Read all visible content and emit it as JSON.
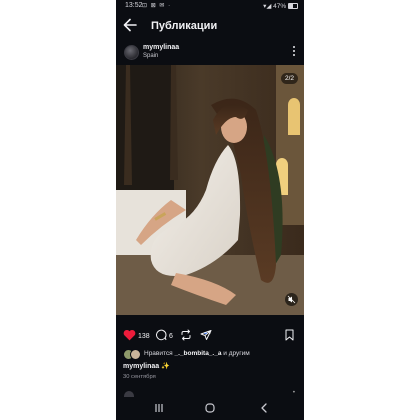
{
  "status_bar": {
    "time": "13:52",
    "left_icons": "⊡ ⊠ ✉ ·",
    "battery": "47%"
  },
  "header": {
    "title": "Публикации",
    "back_icon": "arrow-left-icon"
  },
  "post": {
    "username": "mymylinaa",
    "location": "Spain",
    "media_counter": "2/2",
    "likes": "138",
    "comments": "6",
    "liked_by_prefix": "Нравится ",
    "liked_by_user": "_._bombita_._a",
    "liked_by_suffix": " и другим",
    "caption_user": "mymylinaa",
    "caption_text": " ✨",
    "date": "30 сентября"
  },
  "colors": {
    "background": "#0b0d12",
    "like": "#ed1c3b",
    "active_dot": "#3c7bff"
  }
}
